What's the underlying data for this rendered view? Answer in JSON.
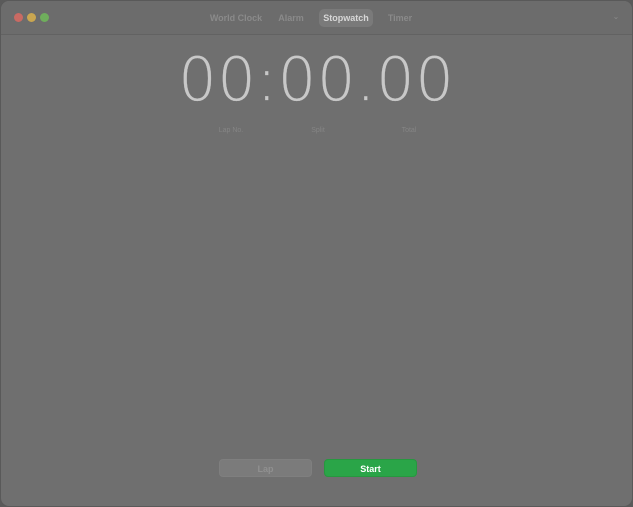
{
  "tabs": [
    {
      "label": "World Clock"
    },
    {
      "label": "Alarm"
    },
    {
      "label": "Stopwatch",
      "selected": true
    },
    {
      "label": "Timer"
    }
  ],
  "stopwatch": {
    "time": "00:00.00"
  },
  "lap_table": {
    "headers": [
      "Lap No.",
      "Split",
      "Total"
    ]
  },
  "buttons": {
    "lap_label": "Lap",
    "start_label": "Start"
  },
  "icons": {
    "more": "chevron-down-icon"
  },
  "colors": {
    "start_button": "#2aa548",
    "close": "#c96a63",
    "minimize": "#c9a650",
    "zoom": "#6fae5c"
  }
}
